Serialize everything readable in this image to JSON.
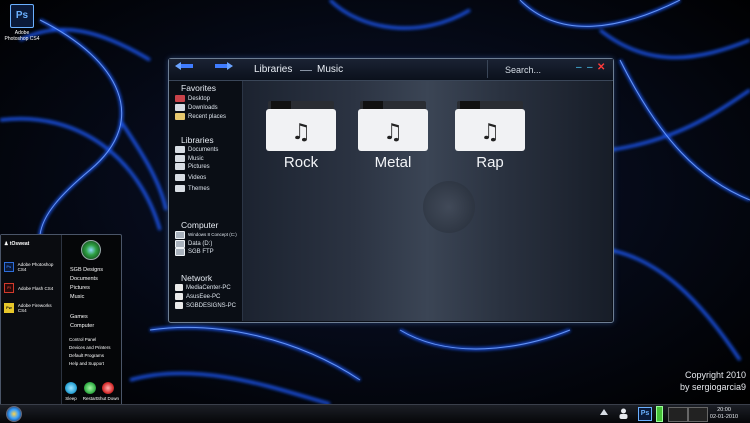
{
  "desktop": {
    "icon": {
      "glyph": "Ps",
      "label_line1": "Adobe",
      "label_line2": "Photoshop CS4"
    }
  },
  "explorer": {
    "breadcrumb": [
      "Libraries",
      "Music"
    ],
    "search_placeholder": "Search...",
    "sidebar": {
      "favorites": {
        "title": "Favorites",
        "items": [
          {
            "label": "Desktop",
            "icon": "desktop-icon"
          },
          {
            "label": "Downloads",
            "icon": "downloads-icon"
          },
          {
            "label": "Recent places",
            "icon": "recent-places-icon"
          }
        ]
      },
      "libraries": {
        "title": "Libraries",
        "items": [
          {
            "label": "Documents",
            "icon": "documents-icon"
          },
          {
            "label": "Music",
            "icon": "music-icon"
          },
          {
            "label": "Pictures",
            "icon": "pictures-icon"
          },
          {
            "label": "Videos",
            "icon": "videos-icon"
          },
          {
            "label": "Themes",
            "icon": "themes-icon"
          }
        ]
      },
      "computer": {
        "title": "Computer",
        "items": [
          {
            "label": "Windows 8 Concept (C:)",
            "icon": "drive-icon"
          },
          {
            "label": "Data (D:)",
            "icon": "drive-icon"
          },
          {
            "label": "SGB FTP",
            "icon": "network-drive-icon"
          }
        ]
      },
      "network": {
        "title": "Network",
        "items": [
          {
            "label": "MediaCenter-PC",
            "icon": "computer-icon"
          },
          {
            "label": "AsusEee-PC",
            "icon": "computer-icon"
          },
          {
            "label": "SGBDESIGNS-PC",
            "icon": "computer-icon"
          }
        ]
      }
    },
    "folders": [
      {
        "label": "Rock",
        "icon": "music-folder-icon"
      },
      {
        "label": "Metal",
        "icon": "music-folder-icon"
      },
      {
        "label": "Rap",
        "icon": "music-folder-icon"
      }
    ]
  },
  "start_menu": {
    "user": "tOsweat",
    "pinned": [
      {
        "label": "Adobe Photoshop CS4",
        "glyph": "Ps",
        "color": "#2e6edb"
      },
      {
        "label": "Adobe Flash CS4",
        "glyph": "Fl",
        "color": "#d33a2c"
      },
      {
        "label": "Adobe Fireworks CS4",
        "glyph": "Fw",
        "color": "#e7c62a"
      }
    ],
    "right_links_group1": [
      "SGB Designs",
      "Documents",
      "Pictures",
      "Music"
    ],
    "right_links_group2": [
      "Games",
      "Computer"
    ],
    "right_links_group3": [
      "Control Panel",
      "Devices and Printers",
      "Default Programs",
      "Help and Support"
    ],
    "power": [
      {
        "label": "Sleep",
        "color": "#2ea7d9"
      },
      {
        "label": "Restart",
        "color": "#38b44a"
      },
      {
        "label": "Shut Down",
        "color": "#d93030"
      }
    ]
  },
  "copyright": {
    "line1": "Copyright 2010",
    "line2": "by sergiogarcia9"
  },
  "taskbar": {
    "tray_ps_glyph": "Ps",
    "time": "20:00",
    "date": "02-01-2010"
  },
  "colors": {
    "accent": "#2f6bff",
    "close": "#ff3b3b",
    "minmax": "#4fd0ff"
  }
}
